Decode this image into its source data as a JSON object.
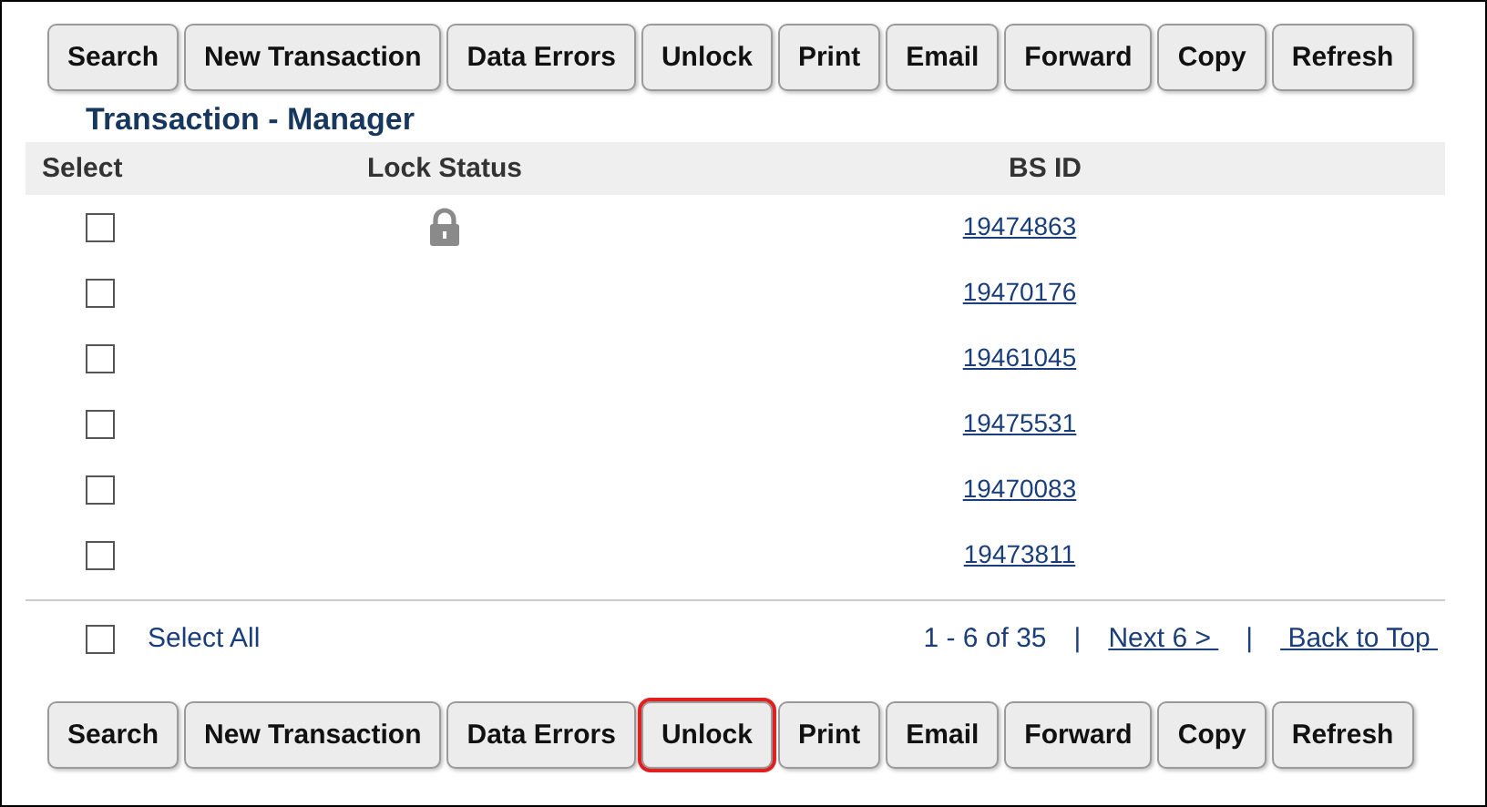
{
  "top_toolbar": [
    {
      "label": "Search",
      "highlighted": false
    },
    {
      "label": "New Transaction",
      "highlighted": false
    },
    {
      "label": "Data Errors",
      "highlighted": false
    },
    {
      "label": "Unlock",
      "highlighted": false
    },
    {
      "label": "Print",
      "highlighted": false
    },
    {
      "label": "Email",
      "highlighted": false
    },
    {
      "label": "Forward",
      "highlighted": false
    },
    {
      "label": "Copy",
      "highlighted": false
    },
    {
      "label": "Refresh",
      "highlighted": false
    }
  ],
  "title": "Transaction - Manager",
  "table": {
    "columns": [
      "Select",
      "Lock Status",
      "BS ID"
    ],
    "rows": [
      {
        "checked": false,
        "locked": true,
        "bs_id": "19474863"
      },
      {
        "checked": false,
        "locked": false,
        "bs_id": "19470176"
      },
      {
        "checked": false,
        "locked": false,
        "bs_id": "19461045"
      },
      {
        "checked": false,
        "locked": false,
        "bs_id": "19475531"
      },
      {
        "checked": false,
        "locked": false,
        "bs_id": "19470083"
      },
      {
        "checked": false,
        "locked": false,
        "bs_id": "19473811"
      }
    ]
  },
  "footer": {
    "select_all": {
      "label": "Select All",
      "checked": false
    },
    "range": "1 - 6 of 35",
    "separators": [
      "|",
      "|"
    ],
    "next": "Next 6 > ",
    "back_to_top": " Back to Top "
  },
  "bottom_toolbar": [
    {
      "label": "Search",
      "highlighted": false
    },
    {
      "label": "New Transaction",
      "highlighted": false
    },
    {
      "label": "Data Errors",
      "highlighted": false
    },
    {
      "label": "Unlock",
      "highlighted": true
    },
    {
      "label": "Print",
      "highlighted": false
    },
    {
      "label": "Email",
      "highlighted": false
    },
    {
      "label": "Forward",
      "highlighted": false
    },
    {
      "label": "Copy",
      "highlighted": false
    },
    {
      "label": "Refresh",
      "highlighted": false
    }
  ]
}
